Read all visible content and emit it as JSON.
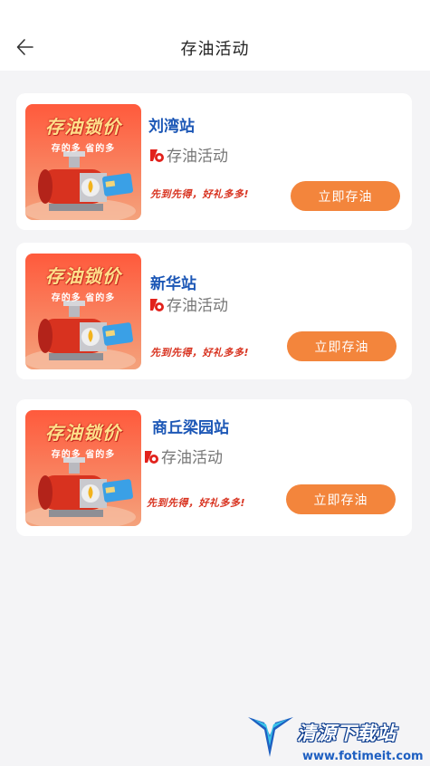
{
  "header": {
    "title": "存油活动"
  },
  "cards": [
    {
      "station": "刘湾站",
      "activity": "存油活动",
      "slogan": "先到先得，好礼多多!",
      "button": "立即存油"
    },
    {
      "station": "新华站",
      "activity": "存油活动",
      "slogan": "先到先得，好礼多多!",
      "button": "立即存油"
    },
    {
      "station": "商丘梁园站",
      "activity": "存油活动",
      "slogan": "先到先得，好礼多多!",
      "button": "立即存油"
    }
  ],
  "poster": {
    "title": "存油锁价",
    "subtitle": "存的多 省的多"
  },
  "watermark": {
    "name": "清源下载站",
    "url": "www.fotimeit.com"
  },
  "colors": {
    "accent": "#f3853c",
    "station_blue": "#1c57b6",
    "slogan_red": "#d8321f",
    "icon_red": "#e2221c"
  },
  "icons": {
    "back": "arrow-left-icon",
    "activity": "activity-logo-icon"
  }
}
